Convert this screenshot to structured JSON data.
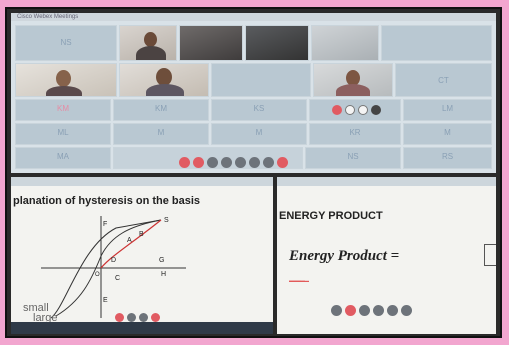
{
  "screen_top": {
    "title": "Cisco Webex Meetings",
    "tiles": [
      {
        "initials": "NS"
      },
      {
        "initials": ""
      },
      {
        "initials": ""
      },
      {
        "initials": ""
      },
      {
        "initials": ""
      },
      {
        "initials": ""
      },
      {
        "initials": ""
      },
      {
        "initials": ""
      },
      {
        "initials": "CT"
      },
      {
        "initials": "KM"
      },
      {
        "initials": "KM"
      },
      {
        "initials": "KS"
      },
      {
        "initials": ""
      },
      {
        "initials": "LM"
      },
      {
        "initials": "ML"
      },
      {
        "initials": "M"
      },
      {
        "initials": "M"
      },
      {
        "initials": "KR"
      },
      {
        "initials": "M"
      },
      {
        "initials": "MA"
      },
      {
        "initials": "NS"
      },
      {
        "initials": "RS"
      }
    ]
  },
  "screen_bottom_left": {
    "slide_title": "planation of hysteresis on the basis",
    "labels": {
      "s": "S",
      "a": "A",
      "b": "B",
      "g": "G",
      "d": "D",
      "e": "E",
      "f": "F",
      "c": "C",
      "h": "H",
      "o": "O"
    },
    "bottom_text_1": "small",
    "bottom_text_2": "large"
  },
  "screen_bottom_right": {
    "slide_title": "ENERGY PRODUCT",
    "formula": "Energy Product ="
  }
}
